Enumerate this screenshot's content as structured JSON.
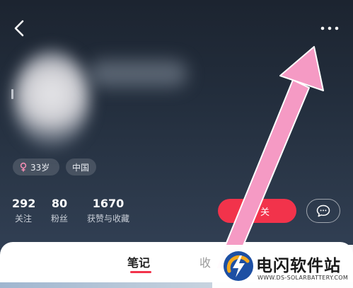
{
  "profile": {
    "age_tag": "33岁",
    "region_tag": "中国"
  },
  "stats": [
    {
      "value": "292",
      "label": "关注"
    },
    {
      "value": "80",
      "label": "粉丝"
    },
    {
      "value": "1670",
      "label": "获赞与收藏"
    }
  ],
  "actions": {
    "follow_label": "关"
  },
  "tabs": {
    "notes": "笔记",
    "collect": "收"
  },
  "watermark": {
    "title": "电闪软件站",
    "url": "WWW.DS-SOLARBATTERY.COM"
  },
  "colors": {
    "accent": "#f2334b",
    "arrow": "#f59ac4",
    "gender_icon": "#f08cb2"
  },
  "icons": {
    "back": "chevron-left",
    "more": "ellipsis",
    "gender": "female",
    "chat": "chat-bubble",
    "logo": "lightning-bolt"
  }
}
